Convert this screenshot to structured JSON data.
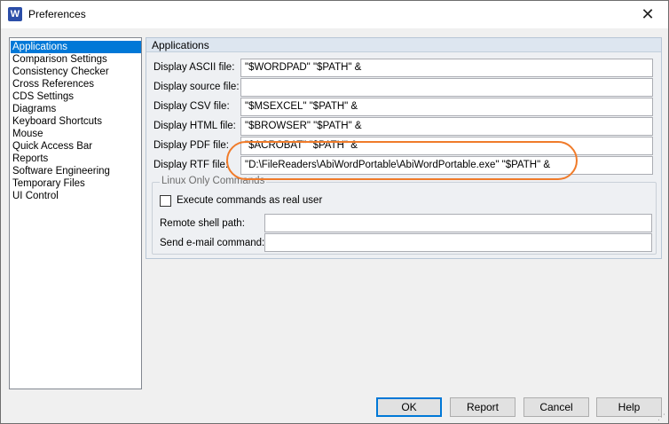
{
  "window": {
    "title": "Preferences",
    "app_icon": "W",
    "close_glyph": "✕"
  },
  "sidebar": {
    "items": [
      {
        "label": "Applications",
        "selected": true
      },
      {
        "label": "Comparison Settings"
      },
      {
        "label": "Consistency Checker"
      },
      {
        "label": "Cross References"
      },
      {
        "label": "CDS Settings"
      },
      {
        "label": "Diagrams"
      },
      {
        "label": "Keyboard Shortcuts"
      },
      {
        "label": "Mouse"
      },
      {
        "label": "Quick Access Bar"
      },
      {
        "label": "Reports"
      },
      {
        "label": "Software Engineering"
      },
      {
        "label": "Temporary Files"
      },
      {
        "label": "UI Control"
      }
    ]
  },
  "main": {
    "group_title": "Applications",
    "rows": [
      {
        "label": "Display ASCII file:",
        "value": "\"$WORDPAD\" \"$PATH\" &"
      },
      {
        "label": "Display source file:",
        "value": ""
      },
      {
        "label": "Display CSV file:",
        "value": "\"$MSEXCEL\" \"$PATH\" &"
      },
      {
        "label": "Display HTML file:",
        "value": "\"$BROWSER\" \"$PATH\" &"
      },
      {
        "label": "Display PDF file:",
        "value": "\"$ACROBAT\" \"$PATH\" &"
      },
      {
        "label": "Display RTF file:",
        "value": "\"D:\\FileReaders\\AbiWordPortable\\AbiWordPortable.exe\" \"$PATH\" &"
      }
    ],
    "linux": {
      "title": "Linux Only Commands",
      "execute_label": "Execute commands as real user",
      "execute_checked": false,
      "remote_shell_label": "Remote shell path:",
      "remote_shell_value": "",
      "email_label": "Send e-mail command:",
      "email_value": ""
    }
  },
  "buttons": {
    "ok": "OK",
    "report": "Report",
    "cancel": "Cancel",
    "help": "Help"
  },
  "colors": {
    "accent": "#0078d7",
    "highlight": "#f07b2a"
  }
}
